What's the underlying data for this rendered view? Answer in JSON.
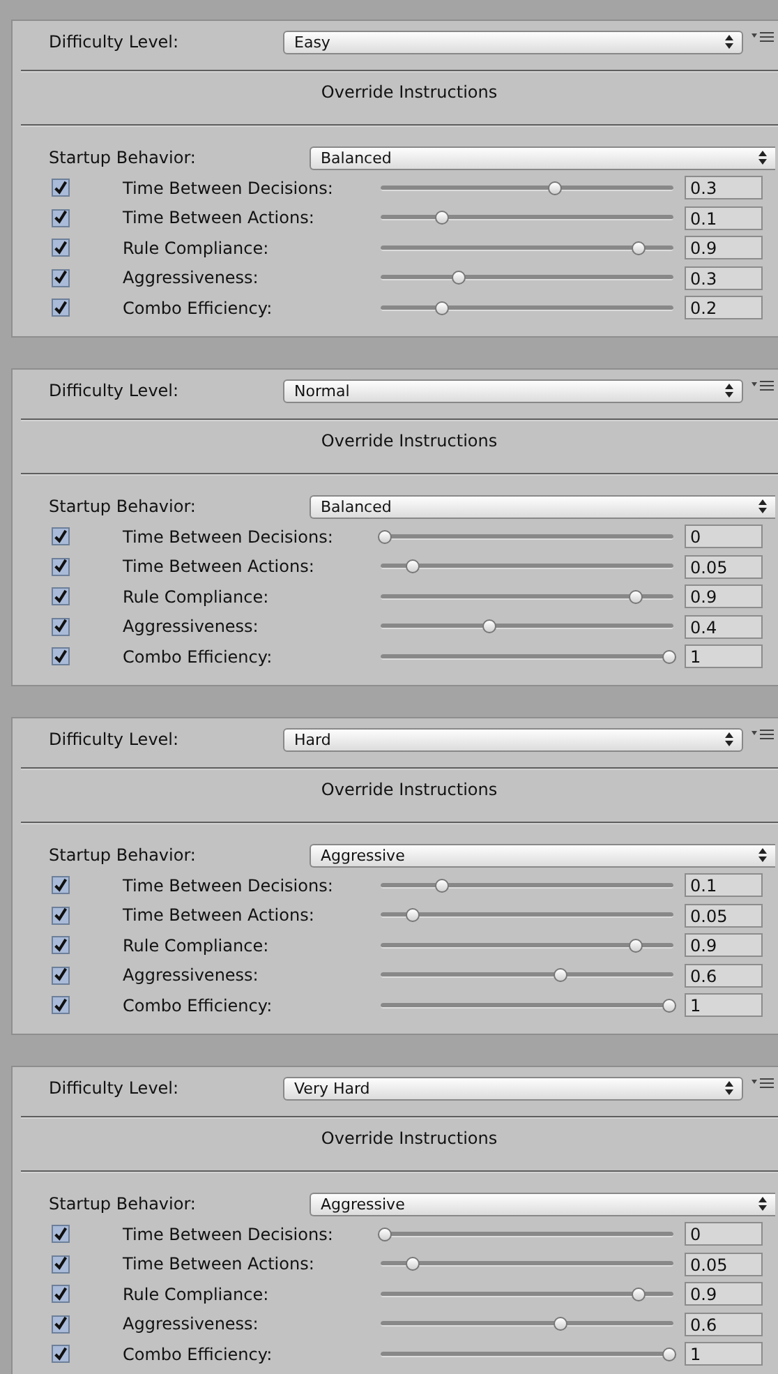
{
  "panels": [
    {
      "difficulty": {
        "label": "Difficulty Level:",
        "value": "Easy"
      },
      "header": "Override Instructions",
      "startup": {
        "label": "Startup Behavior:",
        "value": "Balanced"
      },
      "parameters": [
        {
          "checked": true,
          "name": "Time Between Decisions:",
          "level": 0.6,
          "reading": "0.3"
        },
        {
          "checked": true,
          "name": "Time Between Actions:",
          "level": 0.2,
          "reading": "0.1"
        },
        {
          "checked": true,
          "name": "Rule Compliance:",
          "level": 0.89,
          "reading": "0.9"
        },
        {
          "checked": true,
          "name": "Aggressiveness:",
          "level": 0.26,
          "reading": "0.3"
        },
        {
          "checked": true,
          "name": "Combo Efficiency:",
          "level": 0.2,
          "reading": "0.2"
        }
      ]
    },
    {
      "difficulty": {
        "label": "Difficulty Level:",
        "value": "Normal"
      },
      "header": "Override Instructions",
      "startup": {
        "label": "Startup Behavior:",
        "value": "Balanced"
      },
      "parameters": [
        {
          "checked": true,
          "name": "Time Between Decisions:",
          "level": 0,
          "reading": "0"
        },
        {
          "checked": true,
          "name": "Time Between Actions:",
          "level": 0.1,
          "reading": "0.05"
        },
        {
          "checked": true,
          "name": "Rule Compliance:",
          "level": 0.88,
          "reading": "0.9"
        },
        {
          "checked": true,
          "name": "Aggressiveness:",
          "level": 0.37,
          "reading": "0.4"
        },
        {
          "checked": true,
          "name": "Combo Efficiency:",
          "level": 1,
          "reading": "1"
        }
      ]
    },
    {
      "difficulty": {
        "label": "Difficulty Level:",
        "value": "Hard"
      },
      "header": "Override Instructions",
      "startup": {
        "label": "Startup Behavior:",
        "value": "Aggressive"
      },
      "parameters": [
        {
          "checked": true,
          "name": "Time Between Decisions:",
          "level": 0.2,
          "reading": "0.1"
        },
        {
          "checked": true,
          "name": "Time Between Actions:",
          "level": 0.1,
          "reading": "0.05"
        },
        {
          "checked": true,
          "name": "Rule Compliance:",
          "level": 0.88,
          "reading": "0.9"
        },
        {
          "checked": true,
          "name": "Aggressiveness:",
          "level": 0.62,
          "reading": "0.6"
        },
        {
          "checked": true,
          "name": "Combo Efficiency:",
          "level": 1,
          "reading": "1"
        }
      ]
    },
    {
      "difficulty": {
        "label": "Difficulty Level:",
        "value": "Very Hard"
      },
      "header": "Override Instructions",
      "startup": {
        "label": "Startup Behavior:",
        "value": "Aggressive"
      },
      "parameters": [
        {
          "checked": true,
          "name": "Time Between Decisions:",
          "level": 0,
          "reading": "0"
        },
        {
          "checked": true,
          "name": "Time Between Actions:",
          "level": 0.1,
          "reading": "0.05"
        },
        {
          "checked": true,
          "name": "Rule Compliance:",
          "level": 0.89,
          "reading": "0.9"
        },
        {
          "checked": true,
          "name": "Aggressiveness:",
          "level": 0.62,
          "reading": "0.6"
        },
        {
          "checked": true,
          "name": "Combo Efficiency:",
          "level": 1,
          "reading": "1"
        }
      ]
    }
  ]
}
